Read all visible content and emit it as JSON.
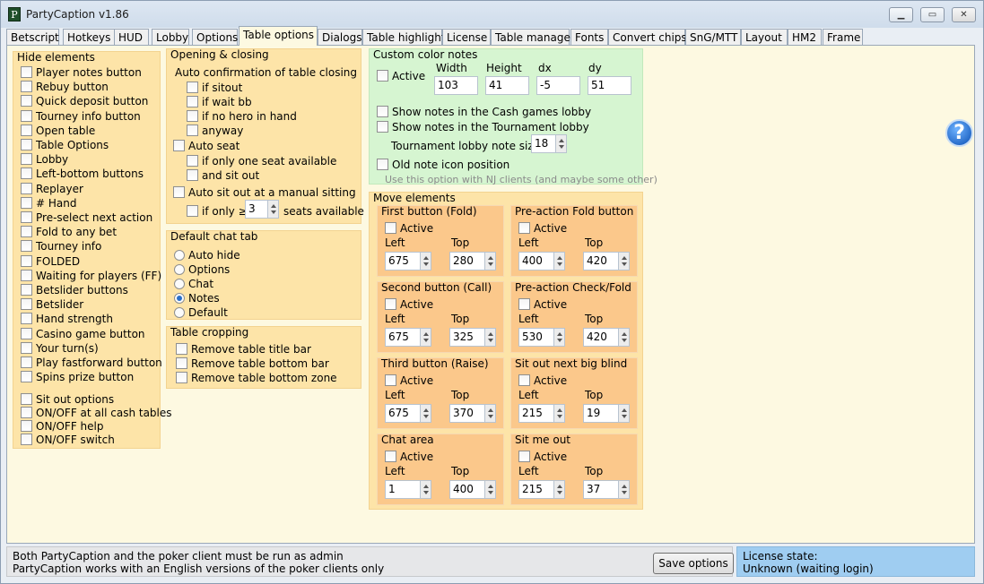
{
  "window": {
    "title": "PartyCaption v1.86",
    "icon_letter": "P"
  },
  "tabs": [
    "Betscript",
    "Hotkeys",
    "HUD",
    "Lobby",
    "Options",
    "Table options",
    "Dialogs",
    "Table highlight",
    "License",
    "Table manager",
    "Fonts",
    "Convert chips",
    "SnG/MTT",
    "Layout",
    "HM2",
    "Frame"
  ],
  "hide_elements": {
    "title": "Hide elements",
    "items": [
      "Player notes button",
      "Rebuy button",
      "Quick deposit button",
      "Tourney info button",
      "Open table",
      "Table Options",
      "Lobby",
      "Left-bottom buttons",
      "Replayer",
      "# Hand",
      "Pre-select next action",
      "Fold to any bet",
      "Tourney info",
      "FOLDED",
      "Waiting for players (FF)",
      "Betslider buttons",
      "Betslider",
      "Hand strength",
      "Casino game button",
      "Your turn(s)",
      "Play fastforward button",
      "Spins prize button"
    ],
    "items2": [
      "Sit out options",
      "ON/OFF at all cash tables",
      "ON/OFF help",
      "ON/OFF switch"
    ]
  },
  "opening": {
    "title": "Opening & closing",
    "auto_confirm": "Auto confirmation of table closing",
    "confirm_items": [
      "if sitout",
      "if wait bb",
      "if no hero in hand",
      "anyway"
    ],
    "auto_seat": "Auto seat",
    "seat_items": [
      "if only one seat available",
      "and sit out"
    ],
    "auto_sitout": "Auto sit out at a manual sitting",
    "if_only": "if only ≥",
    "seats_value": "3",
    "seats_available": "seats available"
  },
  "chat": {
    "title": "Default chat tab",
    "options": [
      "Auto hide",
      "Options",
      "Chat",
      "Notes",
      "Default"
    ],
    "selected": "Notes"
  },
  "cropping": {
    "title": "Table cropping",
    "items": [
      "Remove table title bar",
      "Remove table bottom bar",
      "Remove table bottom zone"
    ]
  },
  "color_notes": {
    "title": "Custom color notes",
    "active": "Active",
    "width_label": "Width",
    "height_label": "Height",
    "dx_label": "dx",
    "dy_label": "dy",
    "width": "103",
    "height": "41",
    "dx": "-5",
    "dy": "51",
    "show_cash": "Show notes in the Cash games lobby",
    "show_tourney": "Show notes in the Tournament lobby",
    "tourney_size_label": "Tournament lobby note size",
    "tourney_size": "18",
    "old_icon": "Old note icon position",
    "hint": "Use this option with NJ clients (and maybe some other)"
  },
  "move": {
    "title": "Move elements",
    "active": "Active",
    "left": "Left",
    "top": "Top",
    "blocks": [
      {
        "name": "First button (Fold)",
        "left": "675",
        "top": "280"
      },
      {
        "name": "Pre-action Fold button",
        "left": "400",
        "top": "420"
      },
      {
        "name": "Second button (Call)",
        "left": "675",
        "top": "325"
      },
      {
        "name": "Pre-action Check/Fold",
        "left": "530",
        "top": "420"
      },
      {
        "name": "Third button (Raise)",
        "left": "675",
        "top": "370"
      },
      {
        "name": "Sit out next big blind",
        "left": "215",
        "top": "19"
      },
      {
        "name": "Chat area",
        "left": "1",
        "top": "400"
      },
      {
        "name": "Sit me out",
        "left": "215",
        "top": "37"
      }
    ]
  },
  "status": {
    "line1": "Both PartyCaption and the poker client must be run as admin",
    "line2": "PartyCaption works with an English versions of the poker clients only",
    "save": "Save options",
    "license_label": "License state:",
    "license_value": "Unknown (waiting login)"
  },
  "help": "?"
}
